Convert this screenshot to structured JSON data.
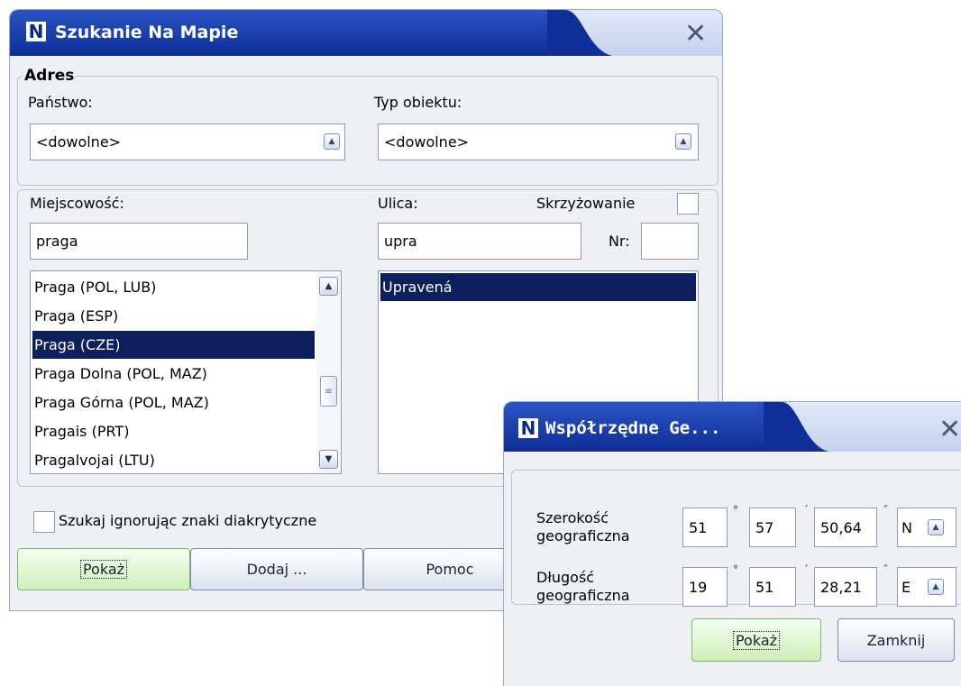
{
  "main_window": {
    "title": "Szukanie Na Mapie",
    "logo": "N",
    "close": "✕",
    "address_group": "Adres",
    "country_label": "Państwo:",
    "country_value": "<dowolne>",
    "object_type_label": "Typ obiektu:",
    "object_type_value": "<dowolne>",
    "city_label": "Miejscowość:",
    "city_value": "praga",
    "street_label": "Ulica:",
    "intersection_label": "Skrzyżowanie",
    "street_value": "upra",
    "number_label": "Nr:",
    "number_value": "",
    "cities": [
      "Praga (POL, LUB)",
      "Praga (ESP)",
      "Praga (CZE)",
      "Praga Dolna (POL, MAZ)",
      "Praga Górna (POL, MAZ)",
      "Pragais (PRT)",
      "Pragalvojai (LTU)"
    ],
    "streets": [
      "Upravená"
    ],
    "ignore_diacritics_label": "Szukaj ignorując znaki diakrytyczne",
    "buttons": {
      "show": "Pokaż",
      "add": "Dodaj ...",
      "help": "Pomoc"
    }
  },
  "geo_window": {
    "title": "Współrzędne Ge...",
    "logo": "N",
    "close": "✕",
    "latitude_label": [
      "Szerokość",
      "geograficzna"
    ],
    "latitude": {
      "deg": "51",
      "min": "57",
      "sec": "50,64",
      "hemisphere": "N"
    },
    "longitude_label": [
      "Długość",
      "geograficzna"
    ],
    "longitude": {
      "deg": "19",
      "min": "51",
      "sec": "28,21",
      "hemisphere": "E"
    },
    "symbols": {
      "deg": "°",
      "min": "´",
      "sec": "˝"
    },
    "buttons": {
      "show": "Pokaż",
      "close": "Zamknij"
    }
  },
  "colors": {
    "title_blue": "#0d2d94",
    "selection": "#0e1f5e",
    "frame_bg": "#eef0f4",
    "primary_button": "#cdeeb9"
  }
}
